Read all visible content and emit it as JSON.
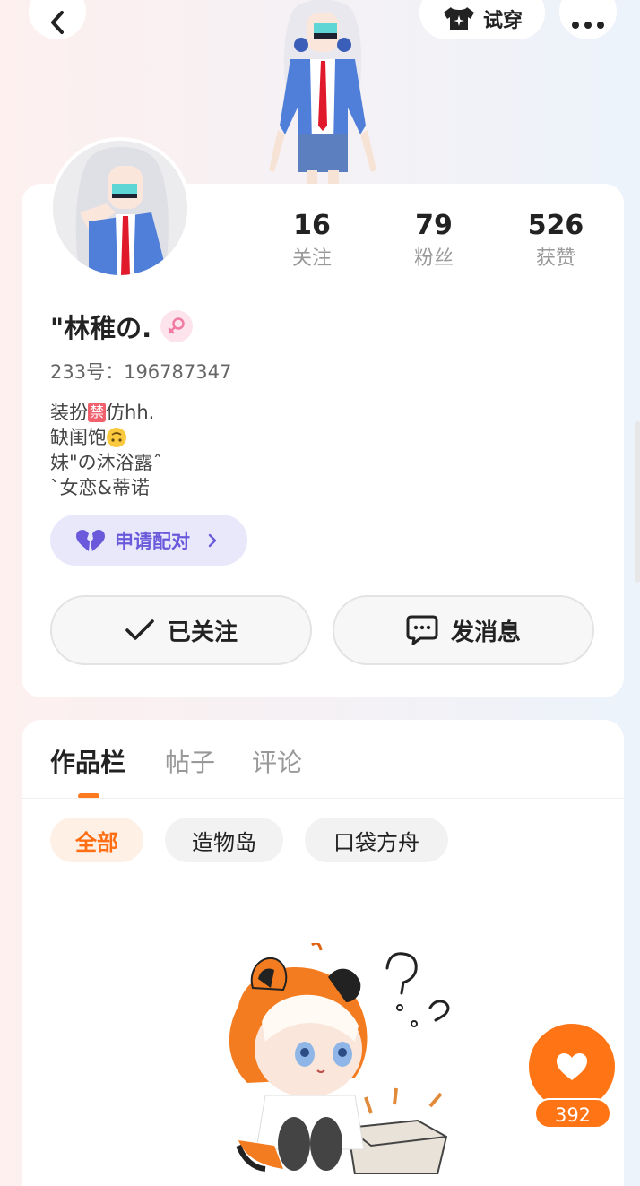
{
  "header": {
    "back_icon": "chevron-left-icon",
    "tryon_label": "试穿",
    "tryon_icon": "shirt-sparkle-icon",
    "more_icon": "more-dots-icon"
  },
  "profile": {
    "stats": [
      {
        "value": "16",
        "label": "关注"
      },
      {
        "value": "79",
        "label": "粉丝"
      },
      {
        "value": "526",
        "label": "获赞"
      }
    ],
    "username": "\"林稚の.",
    "gender_icon": "female-icon",
    "uid": "233号：196787347",
    "bio": {
      "line1_a": "装扮",
      "line1_ban": "禁",
      "line1_b": "仿hh.",
      "line2": "缺闺饱",
      "line3": "妹\"の沐浴露ˆ",
      "line4": "`女恋&蒂诺"
    },
    "pair_label": "申请配对",
    "followed_label": "已关注",
    "message_label": "发消息"
  },
  "works": {
    "tabs": [
      "作品栏",
      "帖子",
      "评论"
    ],
    "active_tab": 0,
    "chips": [
      "全部",
      "造物岛",
      "口袋方舟"
    ],
    "active_chip": 0
  },
  "like": {
    "count": "392"
  },
  "colors": {
    "accent_orange": "#ff7516",
    "pair_purple": "#6a5adb",
    "female_pink": "#f07aa0"
  }
}
